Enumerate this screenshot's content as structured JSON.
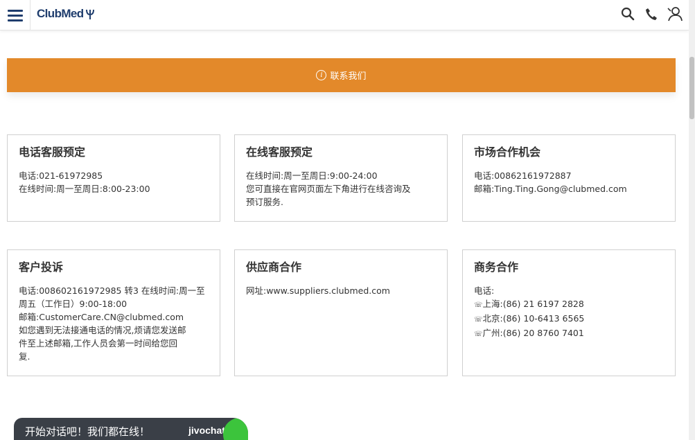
{
  "header": {
    "logo_text": "ClubMed",
    "icons": [
      "menu-icon",
      "search-icon",
      "phone-icon",
      "user-icon"
    ]
  },
  "banner": {
    "label": "联系我们",
    "icon": "info-icon",
    "color": "#e3892a"
  },
  "cards": [
    {
      "title": "电话客服预定",
      "lines": [
        "电话:021-61972985",
        "在线时间:周一至周日:8:00-23:00"
      ]
    },
    {
      "title": "在线客服预定",
      "lines": [
        "在线时间:周一至周日:9:00-24:00",
        "您可直接在官网页面左下角进行在线咨询及",
        "预订服务."
      ]
    },
    {
      "title": "市场合作机会",
      "lines": [
        "电话:00862161972887",
        "邮箱:Ting.Ting.Gong@clubmed.com"
      ]
    },
    {
      "title": "客户投诉",
      "lines": [
        "电话:008602161972985 转3 在线时间:周一至",
        "周五（工作日）9:00-18:00",
        "邮箱:CustomerCare.CN@clubmed.com",
        "如您遇到无法接通电话的情况,烦请您发送邮",
        "件至上述邮箱,工作人员会第一时间给您回",
        "复."
      ]
    },
    {
      "title": "供应商合作",
      "lines": [
        "网址:www.suppliers.clubmed.com"
      ]
    },
    {
      "title": "商务合作",
      "lines": [
        "电话:",
        "上海:(86) 21 6197 2828",
        "北京:(86) 10-6413 6565",
        "广州:(86) 20 8760 7401"
      ],
      "line_prefix": "☏"
    }
  ],
  "chat": {
    "text": "开始对话吧！我们都在线！",
    "brand": "jivochat"
  }
}
